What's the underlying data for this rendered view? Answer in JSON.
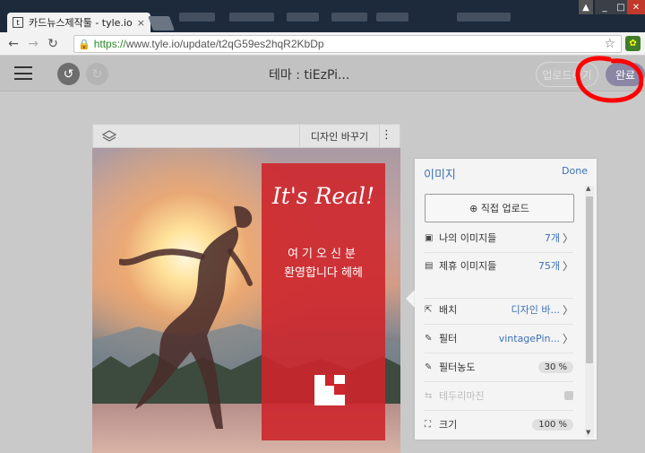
{
  "browser": {
    "tab_title": "카드뉴스제작툴 - tyle.io",
    "tab_favicon": "t",
    "tab_close": "×",
    "window_controls": [
      "▲",
      "_",
      "□",
      "✕"
    ],
    "back": "←",
    "forward": "→",
    "reload": "↻",
    "url_scheme": "https://",
    "url_rest": "www.tyle.io/update/t2qG59es2hqR2KbDp",
    "lock": "🔒",
    "star": "☆",
    "extension": "✿"
  },
  "app": {
    "doc_title": "테마 : tiEzPi...",
    "upload_label": "업로드하기",
    "done_label": "완료",
    "undo": "↺",
    "redo": "↻"
  },
  "card_header": {
    "design_label": "디자인 바꾸기",
    "more": "⋮"
  },
  "card": {
    "headline": "It's Real!",
    "line1": "여기오신분",
    "line2": "환영합니다 헤헤"
  },
  "panel": {
    "title": "이미지",
    "done": "Done",
    "upload_direct": "⊕ 직접 업로드",
    "my_images": {
      "icon": "▣",
      "label": "나의 이미지들",
      "value": "7개",
      "chev": "〉"
    },
    "partner_images": {
      "icon": "▤",
      "label": "제휴 이미지들",
      "value": "75개",
      "chev": "〉"
    },
    "layout": {
      "icon": "⇱",
      "label": "배치",
      "value": "디자인 바...",
      "chev": "〉"
    },
    "filter": {
      "icon": "✎",
      "label": "필터",
      "value": "vintagePin...",
      "chev": "〉"
    },
    "filter_strength": {
      "icon": "✎",
      "label": "필터농도",
      "value": "30 %"
    },
    "border_margin": {
      "icon": "⇆",
      "label": "테두리마진"
    },
    "size": {
      "icon": "⛶",
      "label": "크기",
      "value": "100 %"
    }
  },
  "colors": {
    "accent_blue": "#3a71b8",
    "card_red": "#cd262c",
    "done_button": "#8a86a4",
    "annotation_red": "#ff0000"
  }
}
